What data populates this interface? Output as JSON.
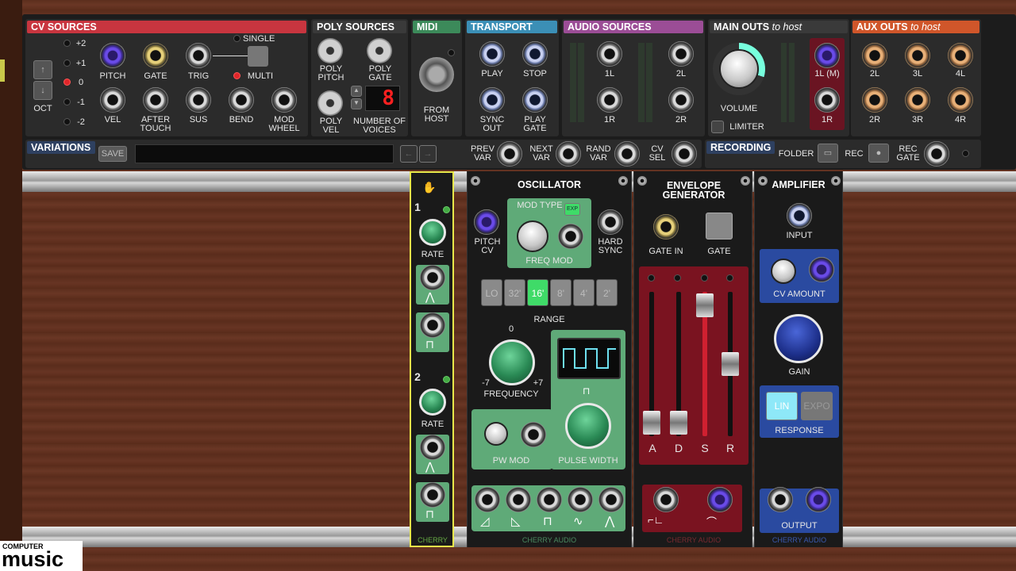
{
  "cv_sources": {
    "title": "CV SOURCES",
    "oct_label": "OCT",
    "oct_values": [
      "+2",
      "+1",
      "0",
      "-1",
      "-2"
    ],
    "jacks_row1": [
      "PITCH",
      "GATE",
      "TRIG"
    ],
    "jacks_row2": [
      "VEL",
      "AFTER TOUCH",
      "SUS",
      "BEND",
      "MOD WHEEL"
    ],
    "single": "SINGLE",
    "multi": "MULTI"
  },
  "poly_sources": {
    "title": "POLY SOURCES",
    "labels": [
      "POLY PITCH",
      "POLY GATE",
      "POLY VEL",
      "NUMBER OF VOICES"
    ],
    "voices": "8"
  },
  "midi": {
    "title": "MIDI",
    "label": "FROM HOST"
  },
  "transport": {
    "title": "TRANSPORT",
    "labels": [
      "PLAY",
      "STOP",
      "SYNC OUT",
      "PLAY GATE"
    ]
  },
  "audio_sources": {
    "title": "AUDIO SOURCES",
    "labels": [
      "1L",
      "2L",
      "1R",
      "2R"
    ]
  },
  "main_outs": {
    "title": "MAIN OUTS",
    "suffix": "to host",
    "volume": "VOLUME",
    "limiter": "LIMITER",
    "labels": [
      "1L (M)",
      "1R"
    ]
  },
  "aux_outs": {
    "title": "AUX OUTS",
    "suffix": "to host",
    "labels": [
      "2L",
      "3L",
      "4L",
      "2R",
      "3R",
      "4R"
    ]
  },
  "variations": {
    "title": "VARIATIONS",
    "save": "SAVE",
    "prev": "PREV VAR",
    "next": "NEXT VAR",
    "rand": "RAND VAR",
    "cv": "CV SEL"
  },
  "recording": {
    "title": "RECORDING",
    "folder": "FOLDER",
    "rec": "REC",
    "rec_gate": "REC GATE"
  },
  "lfo": {
    "ch1": "1",
    "ch2": "2",
    "rate": "RATE",
    "brand": "CHERRY"
  },
  "oscillator": {
    "title": "OSCILLATOR",
    "pitch_cv": "PITCH CV",
    "mod_type": "MOD TYPE",
    "exp": "EXP",
    "freq_mod": "FREQ MOD",
    "hard_sync": "HARD SYNC",
    "range_buttons": [
      "LO",
      "32'",
      "16'",
      "8'",
      "4'",
      "2'"
    ],
    "range_active": 2,
    "range": "RANGE",
    "freq_zero": "0",
    "freq_min": "-7",
    "freq_max": "+7",
    "frequency": "FREQUENCY",
    "pw_mod": "PW MOD",
    "pulse_width": "PULSE WIDTH",
    "brand": "CHERRY AUDIO"
  },
  "envelope": {
    "title": "ENVELOPE GENERATOR",
    "gate_in": "GATE IN",
    "gate": "GATE",
    "sliders": [
      "A",
      "D",
      "S",
      "R"
    ],
    "levels": [
      0.05,
      0.05,
      0.9,
      0.35
    ],
    "brand": "CHERRY AUDIO"
  },
  "amplifier": {
    "title": "AMPLIFIER",
    "input": "INPUT",
    "cv_amount": "CV AMOUNT",
    "gain": "GAIN",
    "lin": "LIN",
    "expo": "EXPO",
    "response": "RESPONSE",
    "output": "OUTPUT",
    "brand": "CHERRY AUDIO"
  },
  "watermark": {
    "line1": "COMPUTER",
    "line2": "music"
  },
  "colors": {
    "cv": "#c8353f",
    "poly": "#3a3a3a",
    "midi": "#3c8a5a",
    "transport": "#3b8fb6",
    "audio": "#9b4d96",
    "aux": "#d0562a"
  }
}
